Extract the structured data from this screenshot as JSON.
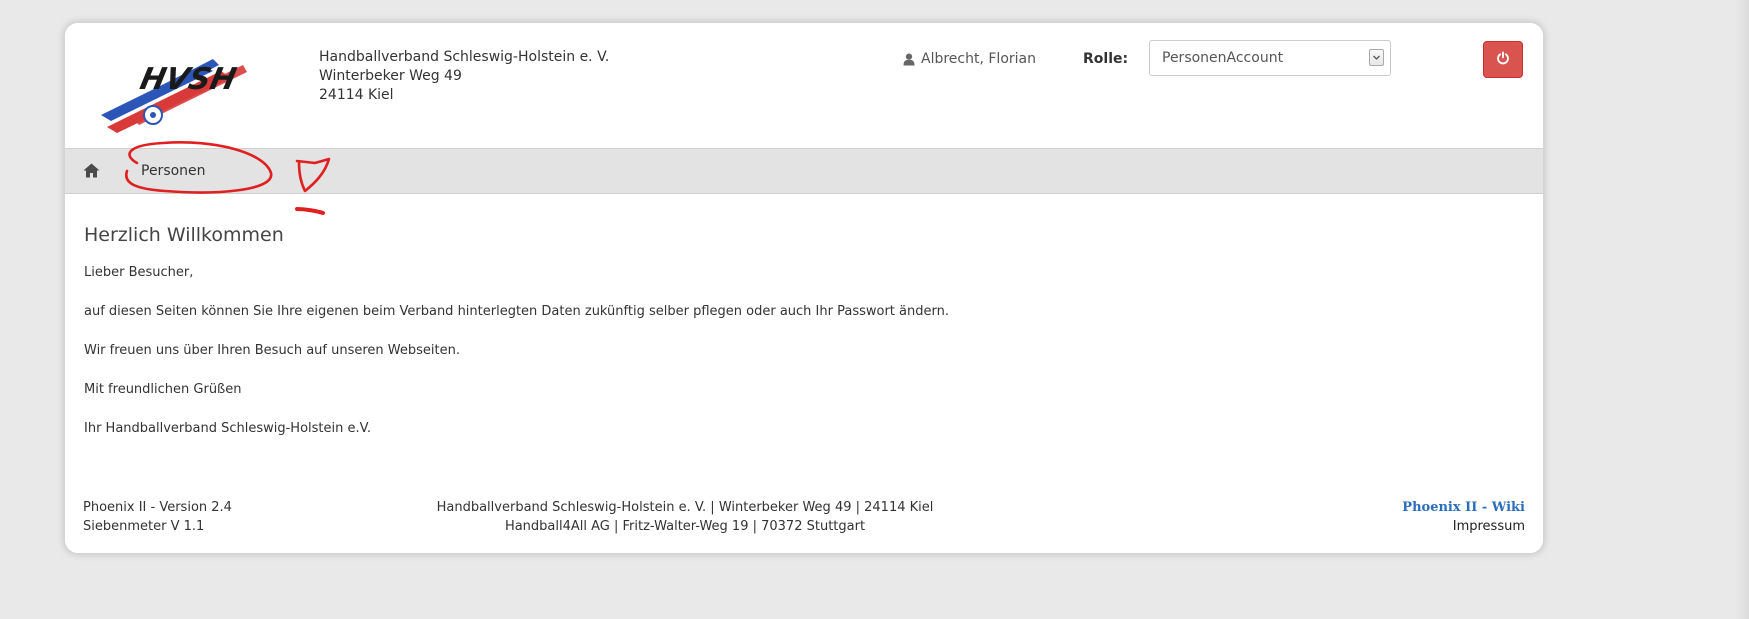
{
  "header": {
    "logo_text": "HVSH",
    "address_lines": [
      "Handballverband Schleswig-Holstein e. V.",
      "Winterbeker Weg 49",
      "24114 Kiel"
    ],
    "user_name": "Albrecht, Florian",
    "user_icon": "user-icon",
    "role_label": "Rolle:",
    "role_selected": "PersonenAccount",
    "logout_icon": "power-icon",
    "logout_color": "#d9534f"
  },
  "breadcrumb": {
    "home_icon": "home-icon",
    "items": [
      "Personen"
    ]
  },
  "annotation": {
    "color": "#e02020",
    "handwritten_mark": "1"
  },
  "main": {
    "title": "Herzlich Willkommen",
    "paragraphs": [
      "Lieber Besucher,",
      "auf diesen Seiten können Sie Ihre eigenen beim Verband hinterlegten Daten zukünftig selber pflegen oder auch Ihr Passwort ändern.",
      "Wir freuen uns über Ihren Besuch auf unseren Webseiten.",
      "Mit freundlichen Grüßen",
      "Ihr Handballverband Schleswig-Holstein e.V."
    ]
  },
  "footer": {
    "left": [
      "Phoenix II - Version 2.4",
      "Siebenmeter V 1.1"
    ],
    "center": [
      "Handballverband Schleswig-Holstein e. V. | Winterbeker Weg 49 | 24114 Kiel",
      "Handball4All AG | Fritz-Walter-Weg 19 | 70372 Stuttgart"
    ],
    "wiki_link": "Phoenix II - Wiki",
    "impressum_link": "Impressum",
    "link_color": "#2a6ebb"
  }
}
